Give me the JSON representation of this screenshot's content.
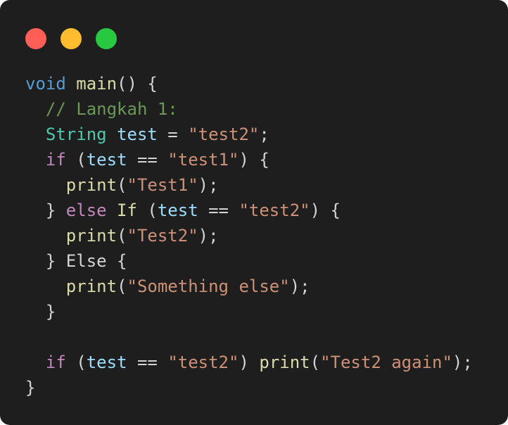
{
  "window": {
    "controls": [
      {
        "name": "close",
        "color": "#ff5f57"
      },
      {
        "name": "minimize",
        "color": "#febc2e"
      },
      {
        "name": "maximize",
        "color": "#28c840"
      }
    ]
  },
  "code": {
    "lines": [
      [
        [
          "keyword",
          "void"
        ],
        [
          "plain",
          " "
        ],
        [
          "function",
          "main"
        ],
        [
          "plain",
          "() {"
        ]
      ],
      [
        [
          "plain",
          "  "
        ],
        [
          "comment",
          "// Langkah 1:"
        ]
      ],
      [
        [
          "plain",
          "  "
        ],
        [
          "type",
          "String"
        ],
        [
          "plain",
          " "
        ],
        [
          "variable",
          "test"
        ],
        [
          "plain",
          " = "
        ],
        [
          "string",
          "\"test2\""
        ],
        [
          "plain",
          ";"
        ]
      ],
      [
        [
          "plain",
          "  "
        ],
        [
          "control",
          "if"
        ],
        [
          "plain",
          " ("
        ],
        [
          "variable",
          "test"
        ],
        [
          "plain",
          " == "
        ],
        [
          "string",
          "\"test1\""
        ],
        [
          "plain",
          ") {"
        ]
      ],
      [
        [
          "plain",
          "    "
        ],
        [
          "function",
          "print"
        ],
        [
          "plain",
          "("
        ],
        [
          "string",
          "\"Test1\""
        ],
        [
          "plain",
          ");"
        ]
      ],
      [
        [
          "plain",
          "  } "
        ],
        [
          "control",
          "else"
        ],
        [
          "plain",
          " "
        ],
        [
          "function",
          "If"
        ],
        [
          "plain",
          " ("
        ],
        [
          "variable",
          "test"
        ],
        [
          "plain",
          " == "
        ],
        [
          "string",
          "\"test2\""
        ],
        [
          "plain",
          ") {"
        ]
      ],
      [
        [
          "plain",
          "    "
        ],
        [
          "function",
          "print"
        ],
        [
          "plain",
          "("
        ],
        [
          "string",
          "\"Test2\""
        ],
        [
          "plain",
          ");"
        ]
      ],
      [
        [
          "plain",
          "  } Else {"
        ]
      ],
      [
        [
          "plain",
          "    "
        ],
        [
          "function",
          "print"
        ],
        [
          "plain",
          "("
        ],
        [
          "string",
          "\"Something else\""
        ],
        [
          "plain",
          ");"
        ]
      ],
      [
        [
          "plain",
          "  }"
        ]
      ],
      [],
      [
        [
          "plain",
          "  "
        ],
        [
          "control",
          "if"
        ],
        [
          "plain",
          " ("
        ],
        [
          "variable",
          "test"
        ],
        [
          "plain",
          " == "
        ],
        [
          "string",
          "\"test2\""
        ],
        [
          "plain",
          ") "
        ],
        [
          "function",
          "print"
        ],
        [
          "plain",
          "("
        ],
        [
          "string",
          "\"Test2 again\""
        ],
        [
          "plain",
          ");"
        ]
      ],
      [
        [
          "plain",
          "}"
        ]
      ]
    ]
  }
}
